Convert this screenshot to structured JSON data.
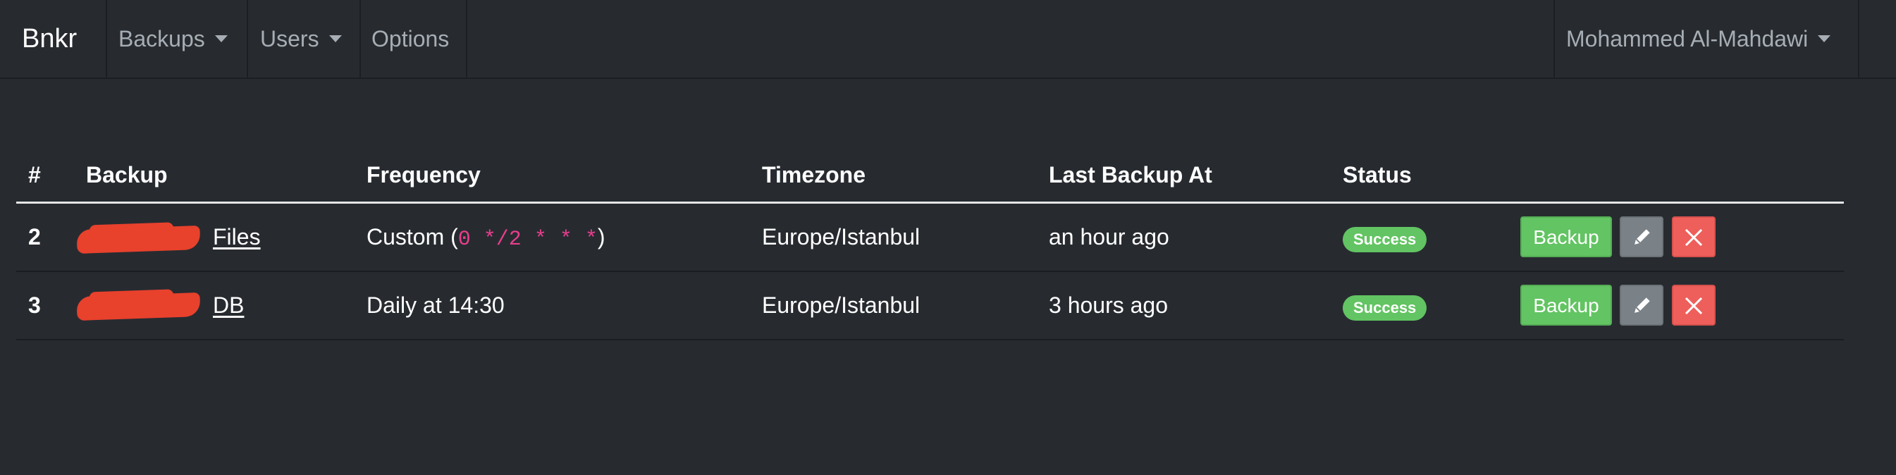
{
  "navbar": {
    "brand": "Bnkr",
    "items": [
      {
        "label": "Backups",
        "has_caret": true
      },
      {
        "label": "Users",
        "has_caret": true
      },
      {
        "label": "Options",
        "has_caret": false
      }
    ],
    "user_menu": {
      "label": "Mohammed Al-Mahdawi",
      "has_caret": true
    }
  },
  "table": {
    "headers": [
      "#",
      "Backup",
      "Frequency",
      "Timezone",
      "Last Backup At",
      "Status"
    ],
    "rows": [
      {
        "id": "2",
        "backup_name_visible": "Files",
        "frequency_text": "Custom (",
        "frequency_code": "0 */2 * * *",
        "frequency_suffix": ")",
        "timezone": "Europe/Istanbul",
        "last_backup": "an hour ago",
        "status": "Success",
        "backup_button": "Backup"
      },
      {
        "id": "3",
        "backup_name_visible": "DB",
        "frequency_text": "Daily at 14:30",
        "frequency_code": "",
        "frequency_suffix": "",
        "timezone": "Europe/Istanbul",
        "last_backup": "3 hours ago",
        "status": "Success",
        "backup_button": "Backup"
      }
    ]
  },
  "colors": {
    "background": "#272b30",
    "success": "#62c462",
    "secondary": "#7a8288",
    "danger": "#ee5f5b",
    "code": "#e83e8c",
    "redaction": "#e8412c"
  },
  "icons": {
    "caret": "chevron-down-icon",
    "edit": "pencil-icon",
    "delete": "close-icon"
  }
}
